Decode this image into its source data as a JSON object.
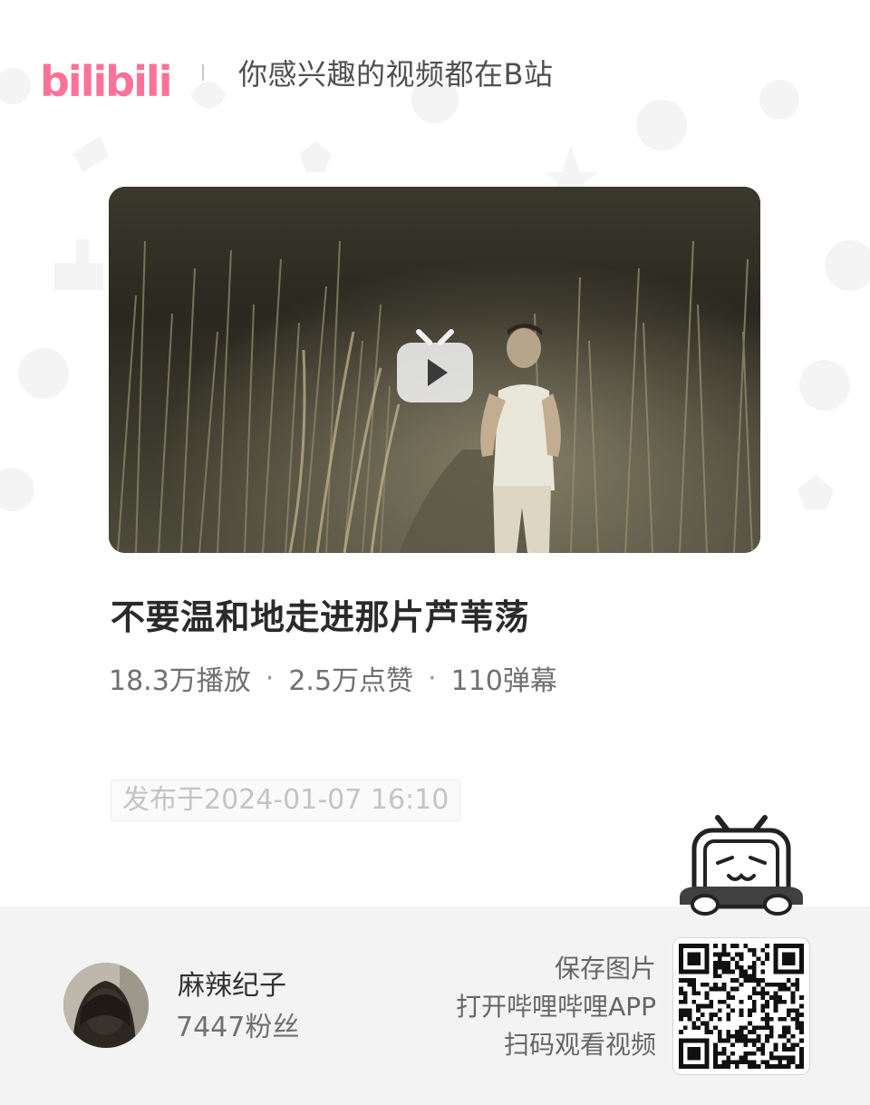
{
  "header": {
    "logo_text": "bilibili",
    "slogan": "你感兴趣的视频都在B站"
  },
  "video": {
    "title": "不要温和地走进那片芦苇荡",
    "stats": {
      "plays": "18.3万播放",
      "likes": "2.5万点赞",
      "danmaku": "110弹幕",
      "separator": "·"
    },
    "publish_time": "发布于2024-01-07 16:10"
  },
  "author": {
    "name": "麻辣纪子",
    "fans": "7447粉丝"
  },
  "qr": {
    "tips": [
      "保存图片",
      "打开哔哩哔哩APP",
      "扫码观看视频"
    ]
  },
  "colors": {
    "brand_pink": "#fb7299",
    "footer_bg": "#f3f3f3"
  }
}
